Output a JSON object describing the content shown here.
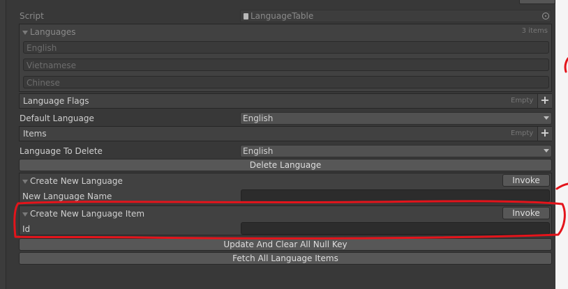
{
  "script_row": {
    "label": "Script",
    "value": "LanguageTable"
  },
  "languages": {
    "title": "Languages",
    "count": "3 items",
    "items": [
      "English",
      "Vietnamese",
      "Chinese"
    ]
  },
  "language_flags": {
    "label": "Language Flags",
    "state": "Empty"
  },
  "default_language": {
    "label": "Default Language",
    "value": "English"
  },
  "items_list": {
    "label": "Items",
    "state": "Empty"
  },
  "language_to_delete": {
    "label": "Language To Delete",
    "value": "English"
  },
  "delete_button": "Delete Language",
  "create_language": {
    "title": "Create New Language",
    "invoke": "Invoke",
    "field_label": "New Language Name",
    "field_value": ""
  },
  "create_item": {
    "title": "Create New Language Item",
    "invoke": "Invoke",
    "field_label": "Id",
    "field_value": ""
  },
  "update_button": "Update And Clear All Null Key",
  "fetch_button": "Fetch All Language Items",
  "annotation_color": "#e4141b"
}
